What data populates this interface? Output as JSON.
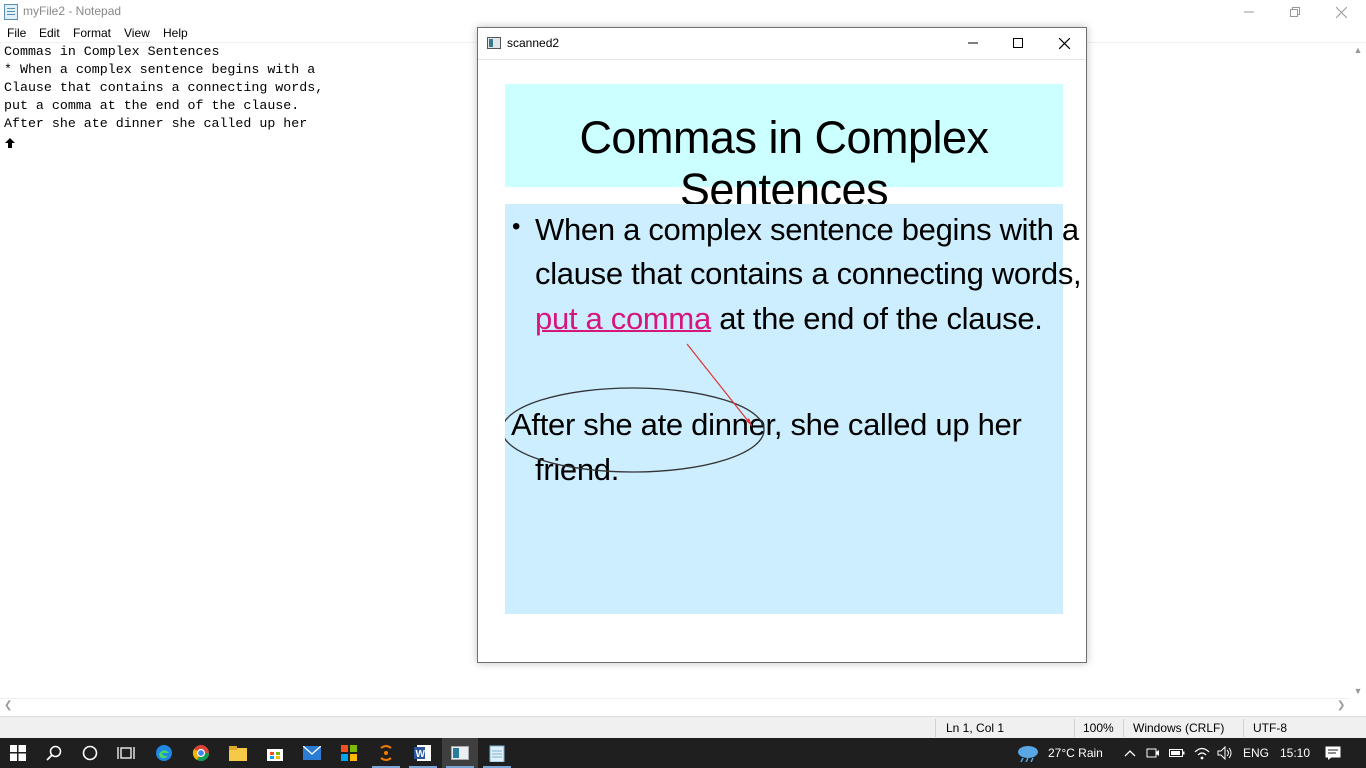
{
  "notepad": {
    "title": "myFile2 - Notepad",
    "menu": [
      "File",
      "Edit",
      "Format",
      "View",
      "Help"
    ],
    "lines": [
      "Commas in Complex Sentences",
      "* When a complex sentence begins with a",
      "Clause that contains a connecting words,",
      "put a comma at the end of the clause.",
      "After she ate dinner she called up her"
    ],
    "status": {
      "position": "Ln 1, Col 1",
      "zoom": "100%",
      "line_ending": "Windows (CRLF)",
      "encoding": "UTF-8"
    }
  },
  "viewer": {
    "title": "scanned2",
    "slide": {
      "title": "Commas in Complex Sentences",
      "bullet_line1": "When a complex sentence begins with a",
      "bullet_line2": "clause that contains a connecting words,",
      "bullet_line3_highlight": "put a comma",
      "bullet_line3_rest": " at the end of the clause.",
      "example_circled": "After she ate dinner,",
      "example_rest": " she called up her",
      "example_line2": "friend.",
      "colors": {
        "title_bg": "#ccffff",
        "body_bg": "#cceeff",
        "highlight": "#d6157f",
        "annotation": "#e53333"
      }
    }
  },
  "taskbar": {
    "weather": "27°C  Rain",
    "language": "ENG",
    "time": "15:10",
    "icons": [
      "windows-start-icon",
      "search-icon",
      "cortana-icon",
      "task-view-icon",
      "edge-icon",
      "chrome-icon",
      "file-explorer-icon",
      "store-icon",
      "mail-icon",
      "office-icon",
      "app-icon",
      "word-icon",
      "viewer-icon",
      "notepad-icon"
    ]
  }
}
